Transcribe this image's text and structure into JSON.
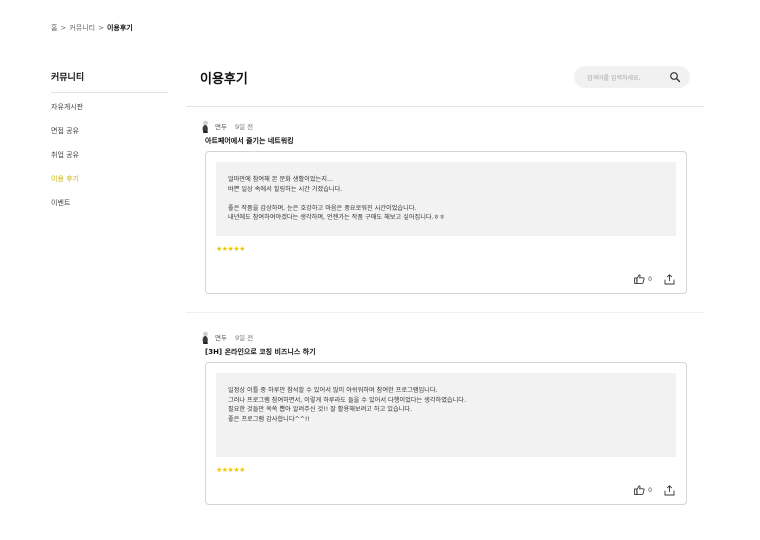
{
  "breadcrumb": {
    "home": "홈",
    "community": "커뮤니티",
    "current": "이용후기"
  },
  "sidebar": {
    "title": "커뮤니티",
    "items": [
      {
        "label": "자유게시판",
        "active": false
      },
      {
        "label": "면접 공유",
        "active": false
      },
      {
        "label": "취업 공유",
        "active": false
      },
      {
        "label": "이용 후기",
        "active": true
      },
      {
        "label": "이벤트",
        "active": false
      }
    ]
  },
  "main": {
    "title": "이용후기",
    "search": {
      "placeholder": "검색어를 입력하세요."
    }
  },
  "posts": [
    {
      "author": "면두",
      "time": "9일 전",
      "title": "아트페어에서 즐기는 네트워킹",
      "body": [
        "얼마만에 참여해 본 문화 생활이었는지...",
        "바쁜 일상 속에서 힐링하는 시간 가졌습니다.",
        "",
        "좋은 작품을 감상하며, 눈은 호강하고 마음은 풍요로워진 시간이었습니다.",
        "내년에도 참여하여야겠다는 생각하며, 언젠가는 작품 구매도 해보고 싶어집니다.ㅎㅎ"
      ],
      "stars": "★★★★★",
      "rating": 5,
      "likes": "0"
    },
    {
      "author": "면두",
      "time": "9일 전",
      "title": "[3H] 온라인으로 코칭 비즈니스 하기",
      "body": [
        "일정상 이틀 중 하루만 참석할 수 있어서 많이 아쉬워하며 참여한 프로그램입니다.",
        "그러나 프로그램 참여하면서, 이렇게 하루라도 들을 수 있어서 다행이었다는 생각하였습니다.",
        "필요한 것들만 쏙쏙 뽑아 알려주신 것!! 잘 활용해보려고 하고 있습니다.",
        "좋은 프로그램 감사합니다^^!!"
      ],
      "stars": "★★★★★",
      "rating": 5,
      "likes": "0"
    }
  ],
  "colors": {
    "accent": "#c9b300",
    "star": "#f0c800",
    "card_bg": "#f2f2f2",
    "search_bg": "#f1f1f1"
  },
  "icons": {
    "search": "search-icon",
    "like": "thumbs-up-icon",
    "share": "share-icon",
    "avatar": "avatar-icon"
  }
}
